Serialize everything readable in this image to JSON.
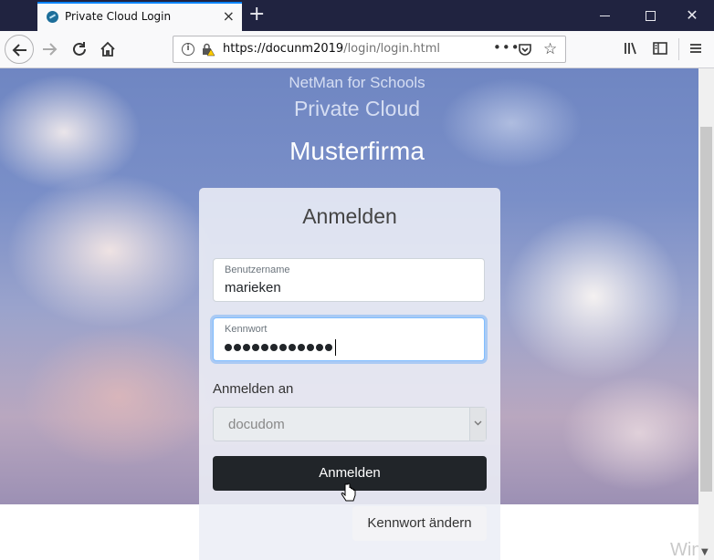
{
  "browser": {
    "tab_title": "Private Cloud Login",
    "tab_close": "×",
    "new_tab": "+",
    "url_main": "https://docunm2019",
    "url_path": "/login/login.html",
    "url_more": "•••",
    "bookmark": "☆",
    "win_close": "✕",
    "icons": [
      "back-icon",
      "forward-icon",
      "reload-icon",
      "home-icon",
      "info-icon",
      "lock-warning-icon",
      "pocket-icon",
      "star-icon",
      "library-icon",
      "sidebar-icon",
      "menu-icon"
    ]
  },
  "header": {
    "product_line": "NetMan for Schools",
    "product_name": "Private Cloud",
    "company": "Musterfirma"
  },
  "login": {
    "title": "Anmelden",
    "username_label": "Benutzername",
    "username_value": "marieken",
    "password_label": "Kennwort",
    "password_length": 12,
    "domain_label": "Anmelden an",
    "domain_value": "docudom",
    "submit_label": "Anmelden",
    "change_password_label": "Kennwort ändern"
  },
  "watermark": "Wind",
  "colors": {
    "accent": "#0a84ff",
    "button_dark": "#212529",
    "tab_strip": "#202340"
  }
}
